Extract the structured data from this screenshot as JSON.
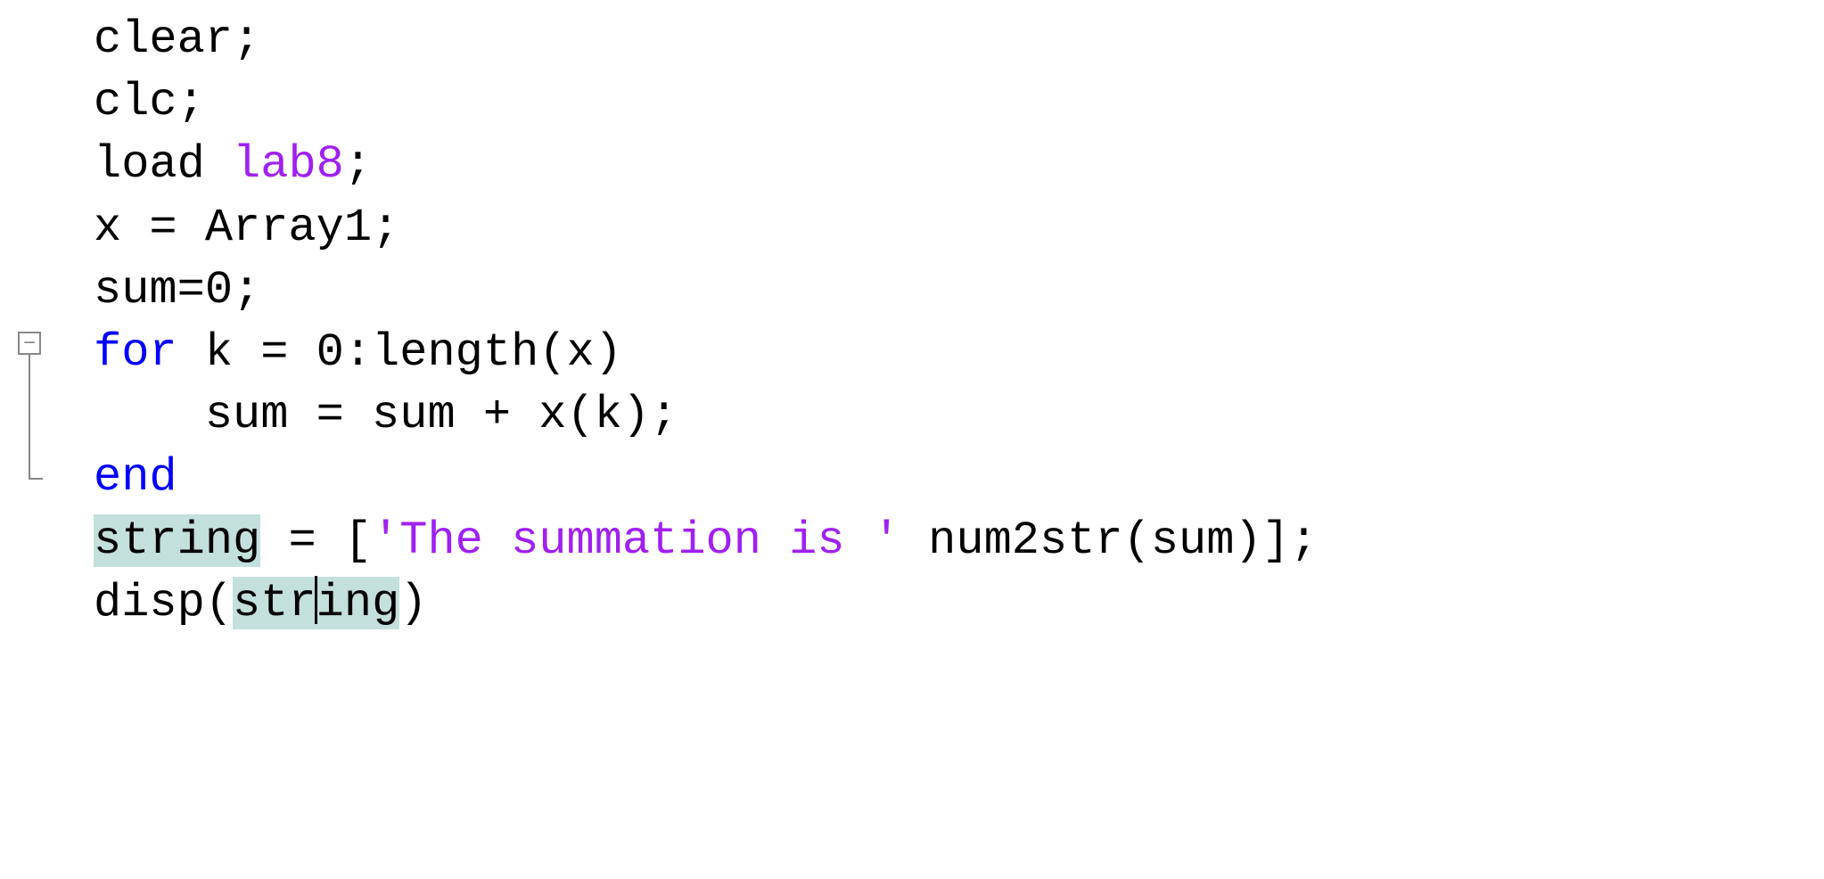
{
  "fold": {
    "minus": "−"
  },
  "code": {
    "l1": "clear;",
    "l2": "clc;",
    "l3_a": "load",
    "l3_b": " ",
    "l3_c": "lab8",
    "l3_d": ";",
    "l4": "x = Array1;",
    "l5": "sum=0;",
    "l6_a": "for",
    "l6_b": " k = 0:length(x)",
    "l7": "    sum = sum + x(k);",
    "l8": "end",
    "l9_a": "string",
    "l9_b": " = [",
    "l9_c": "'The summation is '",
    "l9_d": " num2str(sum)];",
    "l10_a": "disp(",
    "l10_b": "str",
    "l10_c": "ing",
    "l10_d": ")"
  }
}
